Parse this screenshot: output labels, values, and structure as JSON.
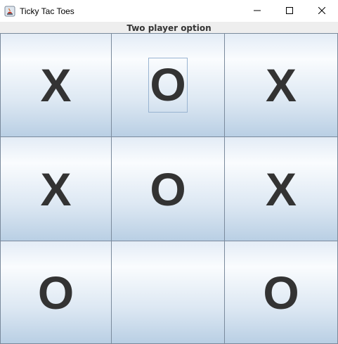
{
  "window": {
    "title": "Ticky Tac Toes",
    "icon": "java-app-icon",
    "controls": [
      "minimize-icon",
      "maximize-icon",
      "close-icon"
    ]
  },
  "subtitle": "Two player option",
  "board": {
    "rows": [
      [
        "X",
        "O",
        "X"
      ],
      [
        "X",
        "O",
        "X"
      ],
      [
        "O",
        "",
        "O"
      ]
    ],
    "focused_cell": "row-1-col-2"
  },
  "colors": {
    "mark": "#333333",
    "cell_gradient_top": "#fafcfe",
    "cell_gradient_bottom": "#b9cfe4",
    "cell_border": "#7a8a9c",
    "focus_border": "#99b4d1"
  }
}
